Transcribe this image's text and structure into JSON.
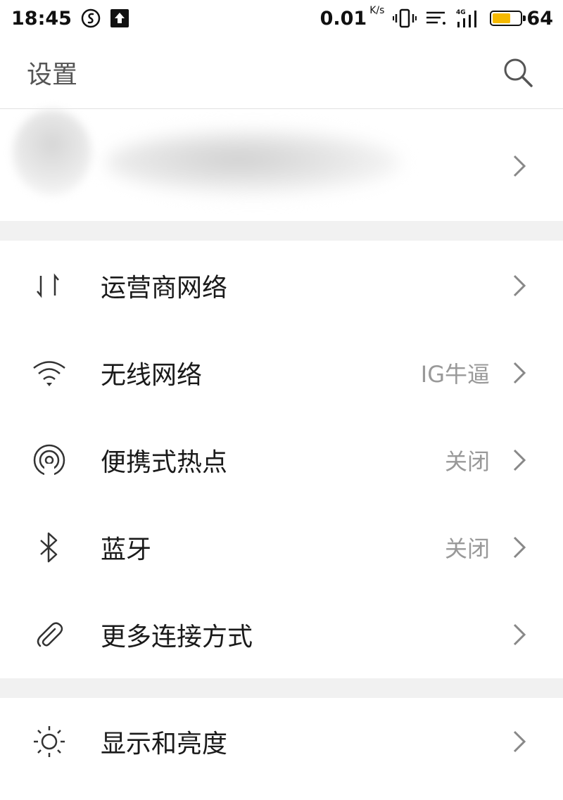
{
  "status_bar": {
    "time": "18:45",
    "net_speed": "0.01",
    "net_speed_unit": "K/s",
    "network_type": "4G",
    "battery_level": "64",
    "battery_color": "#f5b900"
  },
  "header": {
    "title": "设置",
    "search_icon": "search-icon"
  },
  "settings_groups": [
    {
      "items": [
        {
          "label": "运营商网络",
          "value": "",
          "icon": "data-transfer-icon"
        },
        {
          "label": "无线网络",
          "value": "IG牛逼",
          "icon": "wifi-icon"
        },
        {
          "label": "便携式热点",
          "value": "关闭",
          "icon": "hotspot-icon"
        },
        {
          "label": "蓝牙",
          "value": "关闭",
          "icon": "bluetooth-icon"
        },
        {
          "label": "更多连接方式",
          "value": "",
          "icon": "link-icon"
        }
      ]
    },
    {
      "items": [
        {
          "label": "显示和亮度",
          "value": "",
          "icon": "brightness-icon"
        }
      ]
    }
  ],
  "colors": {
    "background": "#ffffff",
    "section_gap": "#f1f1f1",
    "label": "#1a1a1a",
    "secondary_text": "#999999"
  }
}
